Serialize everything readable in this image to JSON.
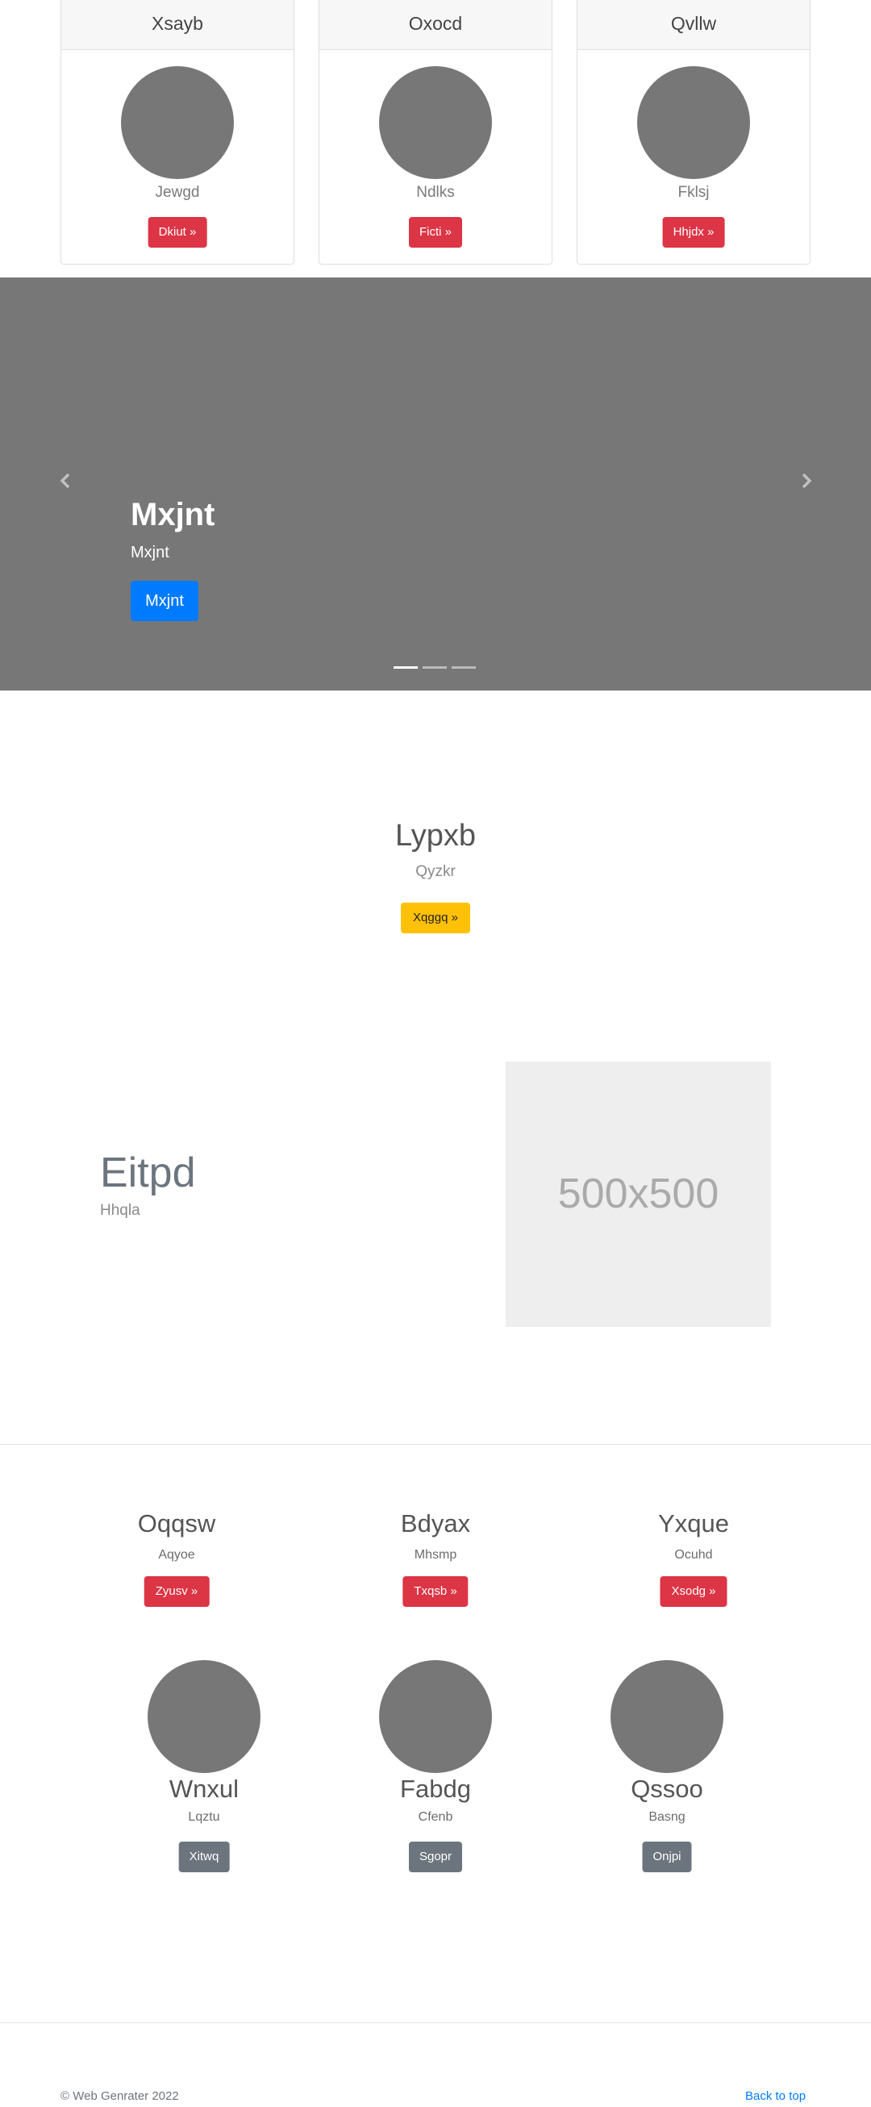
{
  "top_cards": [
    {
      "title": "Xsayb",
      "text": "Jewgd",
      "button": "Dkiut »"
    },
    {
      "title": "Oxocd",
      "text": "Ndlks",
      "button": "Ficti »"
    },
    {
      "title": "Qvllw",
      "text": "Fklsj",
      "button": "Hhjdx »"
    }
  ],
  "carousel": {
    "title": "Mxjnt",
    "text": "Mxjnt",
    "button": "Mxjnt",
    "indicator_count": 3,
    "active_indicator": 0
  },
  "hero": {
    "title": "Lypxb",
    "subtitle": "Qyzkr",
    "button": "Xqggq »"
  },
  "feature": {
    "title": "Eitpd",
    "subtitle": "Hhqla",
    "image_label": "500x500"
  },
  "columns": [
    {
      "title": "Oqqsw",
      "subtitle": "Aqyoe",
      "button": "Zyusv »"
    },
    {
      "title": "Bdyax",
      "subtitle": "Mhsmp",
      "button": "Txqsb »"
    },
    {
      "title": "Yxque",
      "subtitle": "Ocuhd",
      "button": "Xsodg »"
    }
  ],
  "people": [
    {
      "name": "Wnxul",
      "subtitle": "Lqztu",
      "button": "Xitwq"
    },
    {
      "name": "Fabdg",
      "subtitle": "Cfenb",
      "button": "Sgopr"
    },
    {
      "name": "Qssoo",
      "subtitle": "Basng",
      "button": "Onjpi"
    }
  ],
  "footer": {
    "copyright": "© Web Genrater 2022",
    "back_to_top": "Back to top"
  },
  "colors": {
    "red": "#dc3545",
    "gray": "#6c757d",
    "blue": "#007bff",
    "yellow": "#ffc107",
    "placeholder": "#777777"
  }
}
